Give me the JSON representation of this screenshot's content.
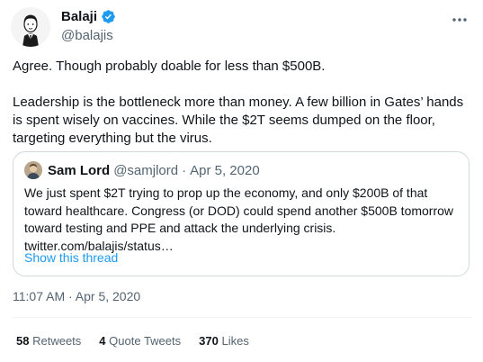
{
  "author": {
    "display_name": "Balaji",
    "handle": "@balajis",
    "verified": true
  },
  "tweet": {
    "paragraphs": [
      "Agree. Though probably doable for less than $500B.",
      "Leadership is the bottleneck more than money. A few billion in Gates’ hands is spent wisely on vaccines. While the $2T seems dumped on the floor, targeting everything but the virus."
    ],
    "timestamp": "11:07 AM · Apr 5, 2020"
  },
  "quote": {
    "name": "Sam Lord",
    "handle": "@samjlord",
    "separator": "·",
    "date": "Apr 5, 2020",
    "text": "We just spent $2T trying to prop up the economy, and only $200B of that toward healthcare. Congress (or DOD) could spend another $500B tomorrow toward testing and PPE and attack the underlying crisis. twitter.com/balajis/status…",
    "show_thread": "Show this thread"
  },
  "stats": [
    {
      "count": "58",
      "label": "Retweets"
    },
    {
      "count": "4",
      "label": "Quote Tweets"
    },
    {
      "count": "370",
      "label": "Likes"
    }
  ],
  "icons": {
    "verified": "verified-badge-icon",
    "more": "more-options-icon"
  },
  "colors": {
    "accent": "#1d9bf0",
    "text": "#0f1419",
    "secondary": "#536471",
    "border": "#cfd9de"
  }
}
